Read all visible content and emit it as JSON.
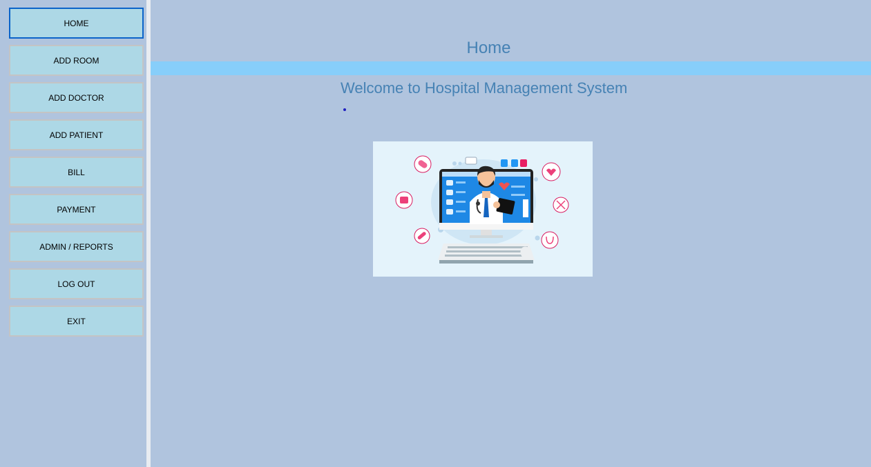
{
  "sidebar": {
    "items": [
      {
        "label": "HOME"
      },
      {
        "label": "ADD ROOM"
      },
      {
        "label": "ADD DOCTOR"
      },
      {
        "label": "ADD PATIENT"
      },
      {
        "label": "BILL"
      },
      {
        "label": "PAYMENT"
      },
      {
        "label": "ADMIN / REPORTS"
      },
      {
        "label": "LOG OUT"
      },
      {
        "label": "EXIT"
      }
    ],
    "active_item": "HOME"
  },
  "main": {
    "title": "Home",
    "welcome": "Welcome to Hospital Management System",
    "image_icon": "doctor-telemedicine-illustration"
  },
  "colors": {
    "background": "#b0c4de",
    "button": "#add8e6",
    "accent_bar": "#87cefa",
    "title_text": "#4682b4",
    "active_border": "#0a63c9"
  }
}
